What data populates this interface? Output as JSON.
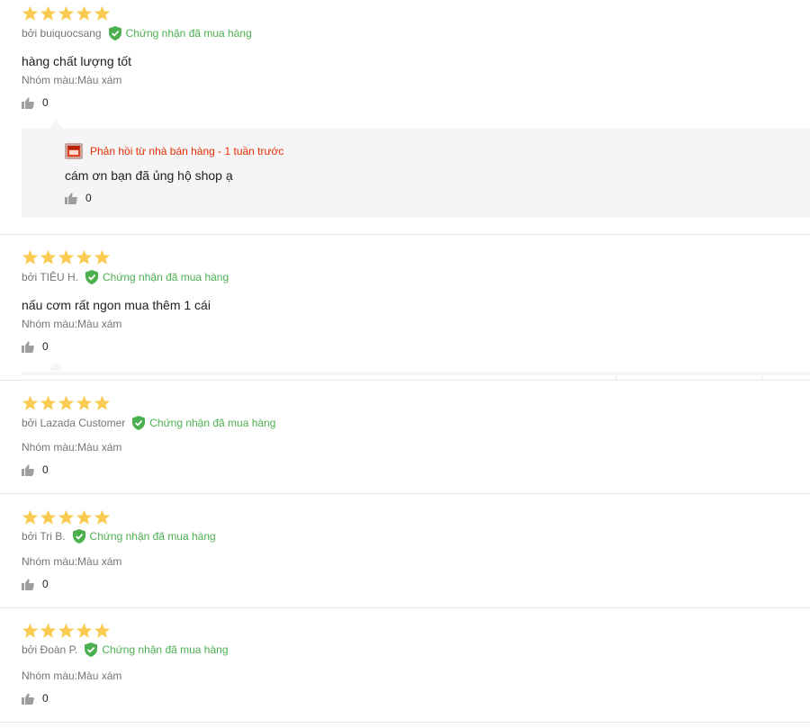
{
  "colors": {
    "star": "#faca51",
    "verified": "#4caf50",
    "reply_accent": "#e62e04",
    "icon_gray": "#9e9e9e",
    "reply_bg": "#f5f5f5"
  },
  "reviews": [
    {
      "rating": 5,
      "author": "bởi buiquocsang",
      "verified_label": "Chứng nhận đã mua hàng",
      "content": "hàng chất lượng tốt",
      "sku": "Nhóm màu:Màu xám",
      "likes": "0",
      "seller_reply": {
        "header": "Phản hồi từ nhà bán hàng - 1 tuần trước",
        "text": "cám ơn bạn đã ủng hộ shop ạ",
        "likes": "0"
      }
    },
    {
      "rating": 5,
      "author": "bởi TIÊU H.",
      "verified_label": "Chứng nhận đã mua hàng",
      "content": "nấu cơm rất ngon mua thêm 1 cái",
      "sku": "Nhóm màu:Màu xám",
      "likes": "0"
    },
    {
      "rating": 5,
      "author": "bởi Lazada Customer",
      "verified_label": "Chứng nhận đã mua hàng",
      "sku": "Nhóm màu:Màu xám",
      "likes": "0"
    },
    {
      "rating": 5,
      "author": "bởi Tri B.",
      "verified_label": "Chứng nhận đã mua hàng",
      "sku": "Nhóm màu:Màu xám",
      "likes": "0"
    },
    {
      "rating": 5,
      "author": "bởi Đoàn P.",
      "verified_label": "Chứng nhận đã mua hàng",
      "sku": "Nhóm màu:Màu xám",
      "likes": "0"
    }
  ]
}
